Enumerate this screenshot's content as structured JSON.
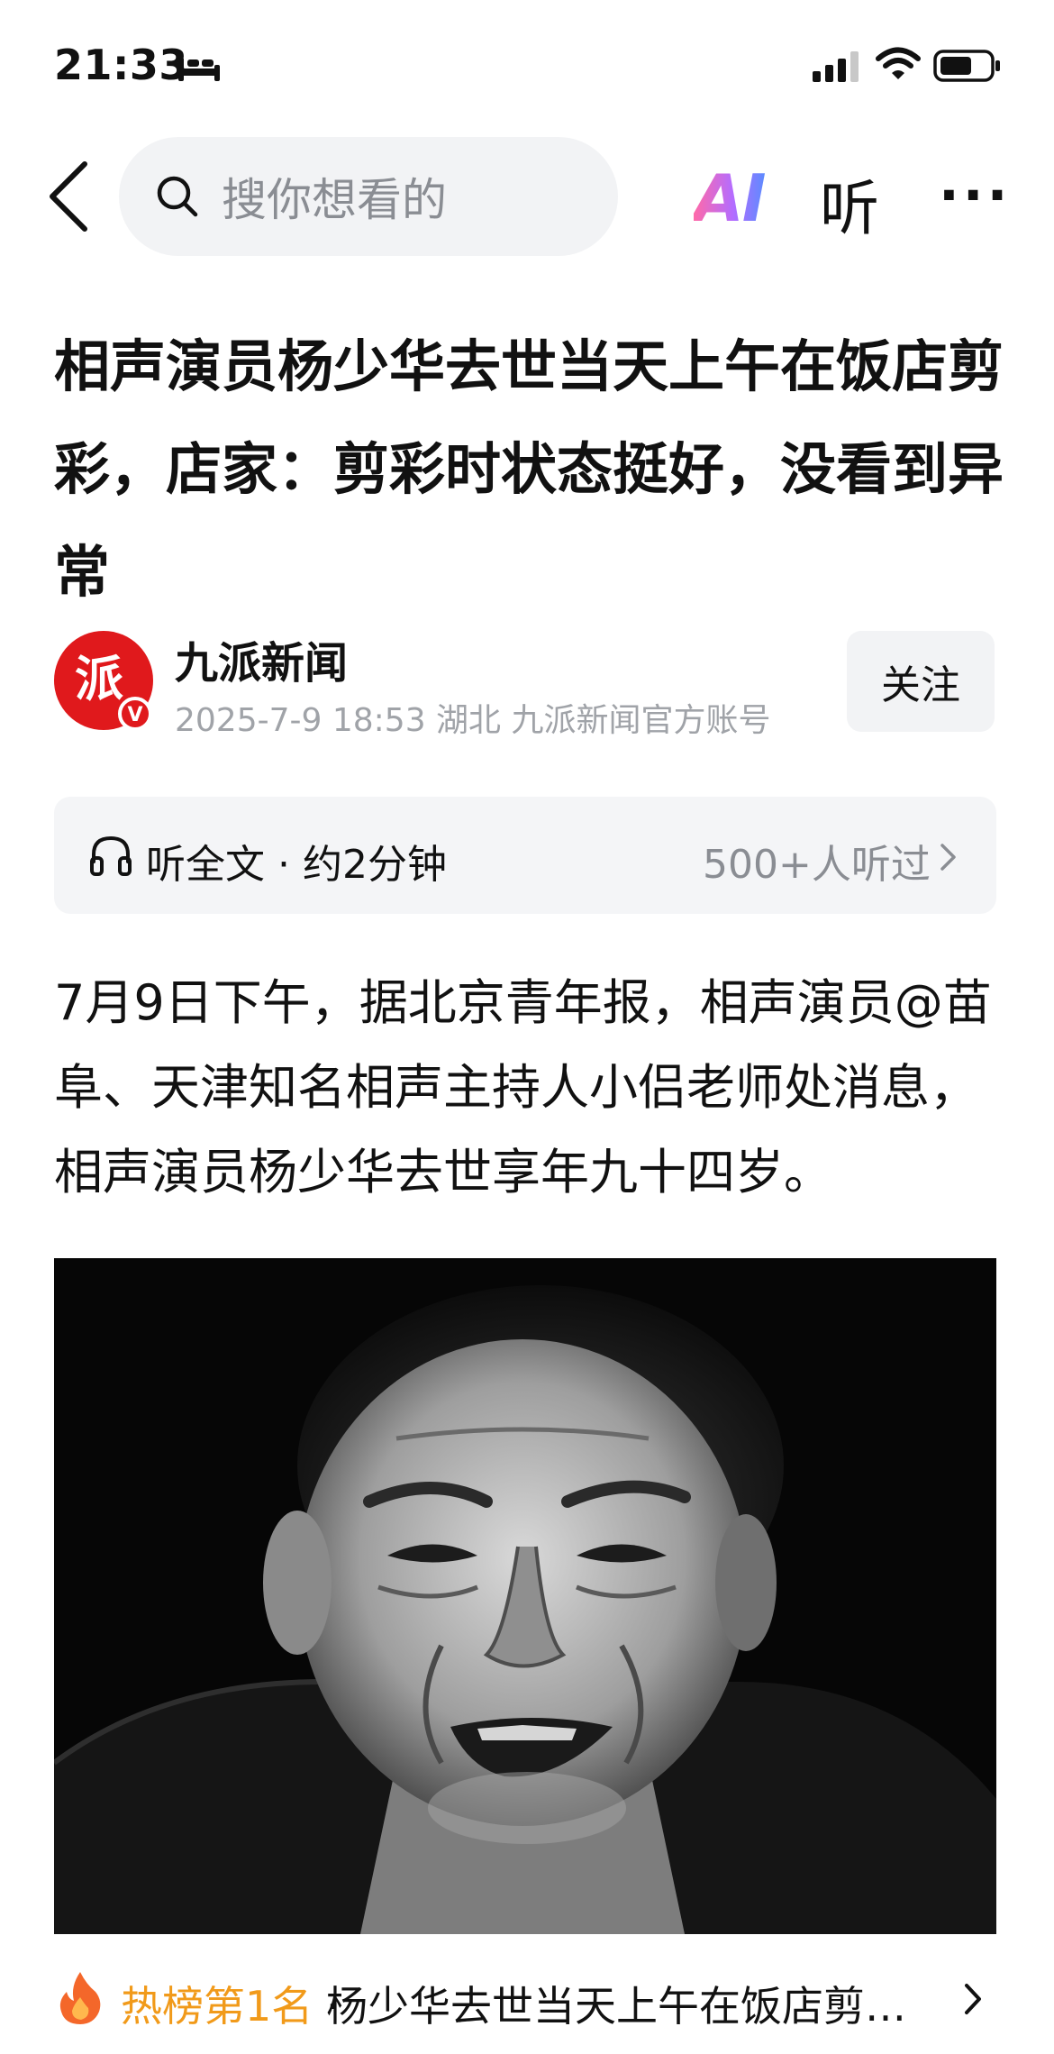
{
  "status_bar": {
    "time": "21:33",
    "icons": [
      "sleep-icon",
      "signal-icon",
      "wifi-icon",
      "battery-icon"
    ]
  },
  "nav": {
    "back_icon": "back-chevron-icon",
    "search_placeholder": "搜你想看的",
    "ai_label": "AI",
    "listen_label": "听",
    "more_label": "···"
  },
  "article": {
    "title": "相声演员杨少华去世当天上午在饭店剪彩，店家：剪彩时状态挺好，没看到异常",
    "author": {
      "name": "九派新闻",
      "meta": "2025-7-9  18:53  湖北  九派新闻官方账号",
      "avatar_char": "派",
      "verified_badge": "V",
      "follow_label": "关注"
    },
    "listen": {
      "label": "听全文 · 约2分钟",
      "count": "500+人听过"
    },
    "body": "7月9日下午，据北京青年报，相声演员@苗阜、天津知名相声主持人小侣老师处消息，相声演员杨少华去世享年九十四岁。"
  },
  "hot_bar": {
    "rank": "热榜第1名",
    "separator": " · ",
    "headline": "杨少华去世当天上午在饭店剪彩，店家：剪彩时状态挺好"
  },
  "colors": {
    "accent_orange": "#f19a1a",
    "avatar_red": "#e0191c",
    "gray_text": "#8a8d93",
    "panel_bg": "#f2f3f5"
  }
}
